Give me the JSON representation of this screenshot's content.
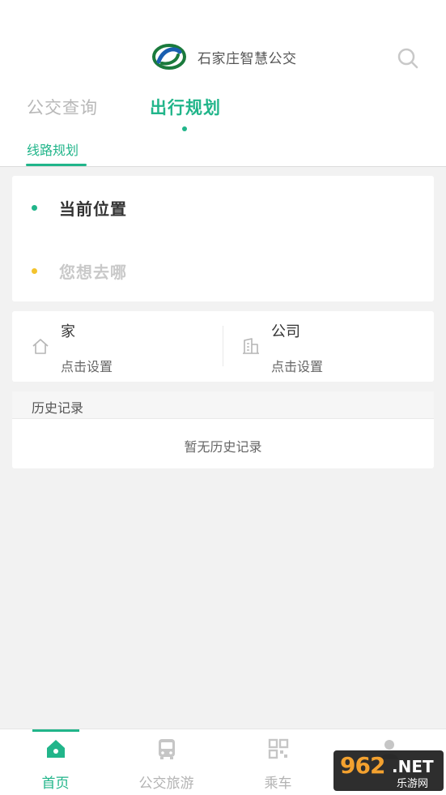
{
  "header": {
    "app_title": "石家庄智慧公交",
    "tabs": [
      {
        "label": "公交查询",
        "active": false
      },
      {
        "label": "出行规划",
        "active": true
      }
    ],
    "subtab": "线路规划"
  },
  "route": {
    "from_label": "当前位置",
    "to_placeholder": "您想去哪"
  },
  "places": [
    {
      "name": "家",
      "sub": "点击设置",
      "icon": "home-icon"
    },
    {
      "name": "公司",
      "sub": "点击设置",
      "icon": "building-icon"
    }
  ],
  "history": {
    "title": "历史记录",
    "empty_text": "暂无历史记录"
  },
  "bottom_nav": [
    {
      "label": "首页",
      "icon": "home-icon",
      "active": true
    },
    {
      "label": "公交旅游",
      "icon": "bus-icon",
      "active": false
    },
    {
      "label": "乘车",
      "icon": "qr-code-icon",
      "active": false
    },
    {
      "label": "",
      "icon": "user-icon",
      "active": false
    }
  ],
  "watermark": {
    "number": "962",
    "suffix": ".NET",
    "site": "乐游网"
  },
  "colors": {
    "accent": "#21b58a",
    "inactive": "#b8b8b8",
    "destination_dot": "#f3c32d",
    "background": "#f2f2f2"
  }
}
